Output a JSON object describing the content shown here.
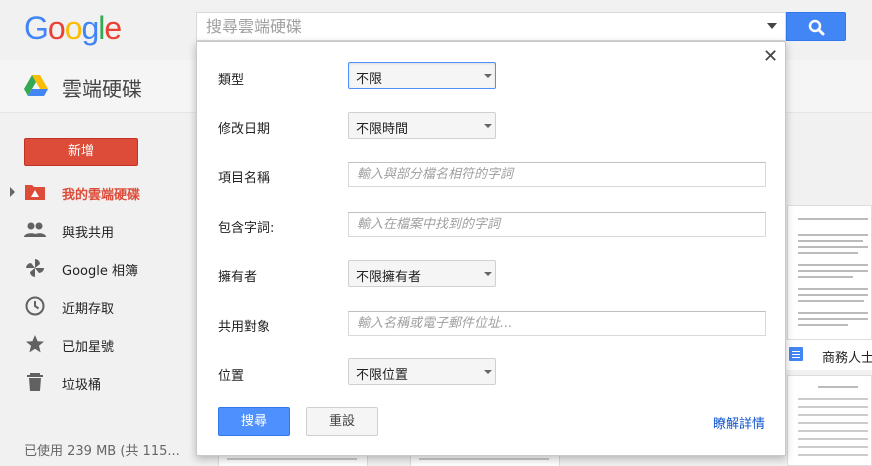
{
  "header": {
    "logo_letters": [
      {
        "char": "G",
        "color": "#4285f4"
      },
      {
        "char": "o",
        "color": "#ea4335"
      },
      {
        "char": "o",
        "color": "#fbbc05"
      },
      {
        "char": "g",
        "color": "#4285f4"
      },
      {
        "char": "l",
        "color": "#34a853"
      },
      {
        "char": "e",
        "color": "#ea4335"
      }
    ],
    "search_placeholder": "搜尋雲端硬碟",
    "search_icon": "magnifier-icon"
  },
  "drive": {
    "title": "雲端硬碟",
    "logo_icon": "google-drive-icon"
  },
  "sidebar": {
    "new_label": "新增",
    "items": [
      {
        "label": "我的雲端硬碟",
        "icon": "my-drive-folder-icon",
        "active": true
      },
      {
        "label": "與我共用",
        "icon": "shared-people-icon",
        "active": false
      },
      {
        "label": "Google 相簿",
        "icon": "photos-pinwheel-icon",
        "active": false
      },
      {
        "label": "近期存取",
        "icon": "clock-icon",
        "active": false
      },
      {
        "label": "已加星號",
        "icon": "star-icon",
        "active": false
      },
      {
        "label": "垃圾桶",
        "icon": "trash-icon",
        "active": false
      }
    ],
    "storage_text": "已使用 239 MB (共 115..."
  },
  "content": {
    "file_card_name": "商務人士"
  },
  "advanced_search": {
    "close_icon": "close-icon",
    "rows": {
      "type": {
        "label": "類型",
        "value": "不限"
      },
      "modified": {
        "label": "修改日期",
        "value": "不限時間"
      },
      "item_name": {
        "label": "項目名稱",
        "placeholder": "輸入與部分檔名相符的字詞"
      },
      "contains": {
        "label": "包含字詞:",
        "placeholder": "輸入在檔案中找到的字詞"
      },
      "owner": {
        "label": "擁有者",
        "value": "不限擁有者"
      },
      "shared_with": {
        "label": "共用對象",
        "placeholder": "輸入名稱或電子郵件位址..."
      },
      "location": {
        "label": "位置",
        "value": "不限位置"
      }
    },
    "search_button": "搜尋",
    "reset_button": "重設",
    "learn_more": "瞭解詳情"
  },
  "colors": {
    "accent_blue": "#4285f4",
    "new_red": "#dd4b39",
    "link_blue": "#1155cc"
  }
}
